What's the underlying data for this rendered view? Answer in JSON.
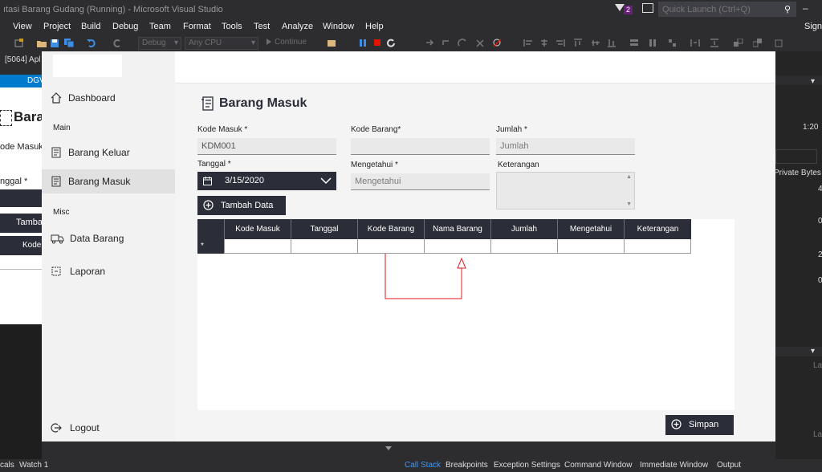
{
  "vs": {
    "title": "ıtasi Barang Gudang (Running) - Microsoft Visual Studio",
    "notification_count": "2",
    "quick_launch_placeholder": "Quick Launch (Ctrl+Q)",
    "menu": [
      "View",
      "Project",
      "Build",
      "Debug",
      "Team",
      "Format",
      "Tools",
      "Test",
      "Analyze",
      "Window",
      "Help"
    ],
    "sign_in": "Sign",
    "toolbar": {
      "config": "Debug",
      "platform": "Any CPU",
      "continue": "Continue"
    },
    "process": "[5064] Apl",
    "doc_tab": "DGV",
    "right_panel": {
      "time_label": "1:20",
      "private_bytes": "Private Bytes",
      "tick_a": "4",
      "tick_b": "0",
      "tick_c": "2",
      "tick_d": "0",
      "col_la1": "La",
      "col_la2": "La"
    },
    "status_tabs": [
      "Call Stack",
      "Breakpoints",
      "Exception Settings",
      "Command Window",
      "Immediate Window",
      "Output"
    ],
    "status_left": [
      "cals",
      "Watch 1"
    ]
  },
  "background_form": {
    "heading": "Bara",
    "label_kode": "ode Masuk *",
    "label_tanggal": "nggal *",
    "button_tambah": "Tamba",
    "grid_header": "Kode"
  },
  "sidebar": {
    "dashboard": "Dashboard",
    "section_main": "Main",
    "barang_keluar": "Barang Keluar",
    "barang_masuk": "Barang Masuk",
    "section_misc": "Misc",
    "data_barang": "Data Barang",
    "laporan": "Laporan",
    "logout": "Logout"
  },
  "page": {
    "title": "Barang Masuk"
  },
  "form": {
    "kode_masuk": {
      "label": "Kode Masuk *",
      "value": "KDM001"
    },
    "kode_barang": {
      "label": "Kode Barang*",
      "value": ""
    },
    "jumlah": {
      "label": "Jumlah *",
      "placeholder": "Jumlah"
    },
    "tanggal": {
      "label": "Tanggal *",
      "value": "3/15/2020"
    },
    "mengetahui": {
      "label": "Mengetahui *",
      "placeholder": "Mengetahui"
    },
    "keterangan": {
      "label": "Keterangan",
      "value": ""
    },
    "tambah_button": "Tambah Data",
    "simpan_button": "Simpan"
  },
  "grid": {
    "columns": [
      "Kode Masuk",
      "Tanggal",
      "Kode Barang",
      "Nama Barang",
      "Jumlah",
      "Mengetahui",
      "Keterangan"
    ],
    "new_row_marker": "*"
  },
  "colors": {
    "accent_dark": "#2b2e38",
    "vs_blue": "#007acc",
    "annotation_red": "#e0191b"
  }
}
